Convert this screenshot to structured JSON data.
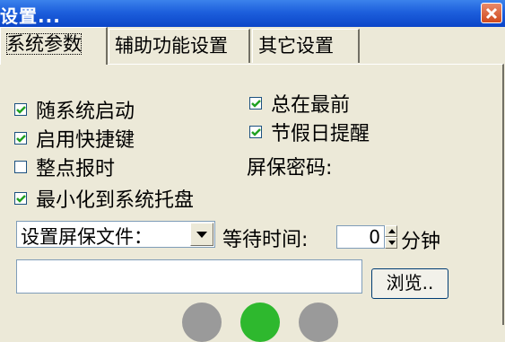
{
  "window": {
    "title": "设置...",
    "close_icon": "close-icon"
  },
  "tabs": [
    {
      "label": "系统参数"
    },
    {
      "label": "辅助功能设置"
    },
    {
      "label": "其它设置"
    }
  ],
  "options": {
    "autostart": {
      "label": "随系统启动",
      "checked": true
    },
    "hotkeys": {
      "label": "启用快捷键",
      "checked": true
    },
    "hourly_chime": {
      "label": "整点报时",
      "checked": false
    },
    "minimize_to_tray": {
      "label": "最小化到系统托盘",
      "checked": true
    },
    "always_on_top": {
      "label": "总在最前",
      "checked": true
    },
    "holiday_reminder": {
      "label": "节假日提醒",
      "checked": true
    }
  },
  "screensaver": {
    "password_label": "屏保密码:",
    "file_select_value": "设置屏保文件：",
    "wait_label": "等待时间:",
    "wait_value": "0",
    "unit_label": "分钟",
    "path_value": "",
    "browse_label": "浏览.."
  },
  "colors": {
    "titlebar": "#1d5fdc",
    "close_button": "#d04a1e",
    "circle_left": "#9a9a9a",
    "circle_middle": "#2eb82e",
    "circle_right": "#9a9a9a"
  }
}
